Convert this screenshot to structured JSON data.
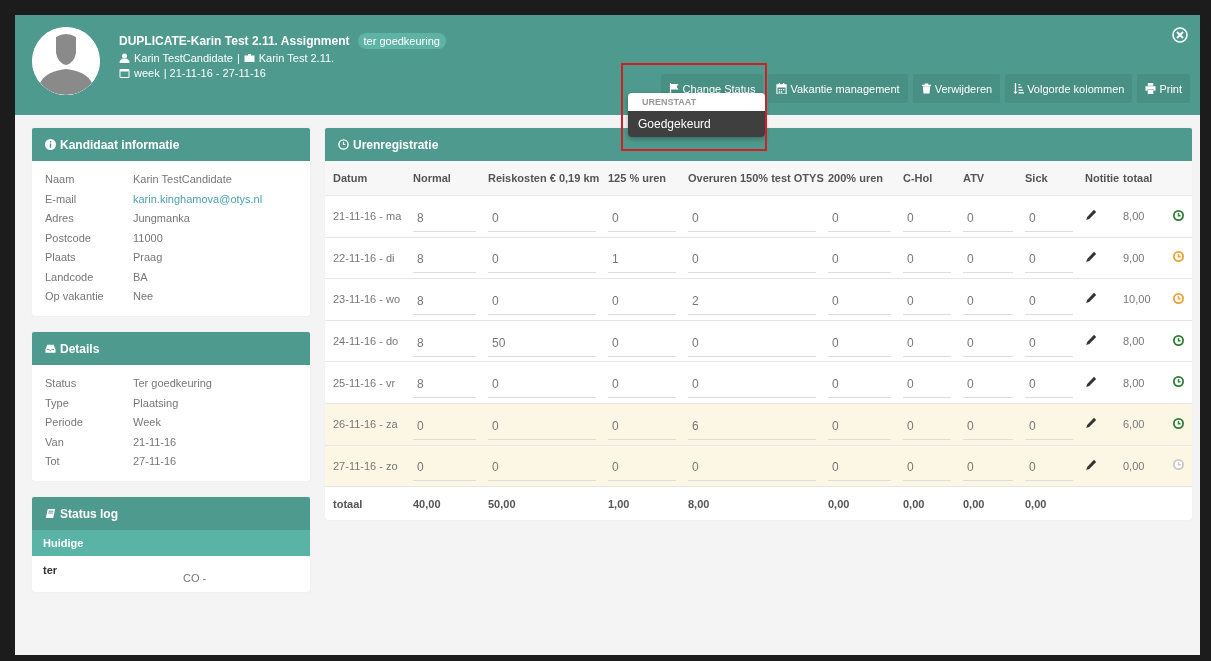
{
  "header": {
    "title": "DUPLICATE-Karin Test 2.11. Assignment",
    "badge": "ter goedkeuring",
    "candidate": "Karin TestCandidate",
    "separator": "|",
    "assignment": "Karin Test 2.11.",
    "period_type": "week",
    "period": "| 21-11-16 - 27-11-16"
  },
  "buttons": [
    {
      "label": "Change Status"
    },
    {
      "label": "Vakantie management"
    },
    {
      "label": "Verwijderen"
    },
    {
      "label": "Volgorde kolommen"
    },
    {
      "label": "Print"
    }
  ],
  "dropdown": {
    "section": "URENSTAAT",
    "items": [
      {
        "label": "Goedgekeurd",
        "selected": true
      }
    ]
  },
  "candidate_card": {
    "title": "Kandidaat informatie",
    "rows": [
      {
        "label": "Naam",
        "value": "Karin TestCandidate",
        "kind": "text"
      },
      {
        "label": "E-mail",
        "value": "karin.kinghamova@otys.nl",
        "kind": "link"
      },
      {
        "label": "Adres",
        "value": "Jungmanka",
        "kind": "text"
      },
      {
        "label": "Postcode",
        "value": "11000",
        "kind": "text"
      },
      {
        "label": "Plaats",
        "value": "Praag",
        "kind": "text"
      },
      {
        "label": "Landcode",
        "value": "BA",
        "kind": "text"
      },
      {
        "label": "Op vakantie",
        "value": "Nee",
        "kind": "text"
      }
    ]
  },
  "details_card": {
    "title": "Details",
    "rows": [
      {
        "label": "Status",
        "value": "Ter goedkeuring"
      },
      {
        "label": "Type",
        "value": "Plaatsing"
      },
      {
        "label": "Periode",
        "value": "Week"
      },
      {
        "label": "Van",
        "value": "21-11-16"
      },
      {
        "label": "Tot",
        "value": "27-11-16"
      }
    ]
  },
  "status_log": {
    "title": "Status log",
    "tab": "Huidige",
    "status": "ter",
    "code": "CO -"
  },
  "timesheet": {
    "title": "Urenregistratie",
    "columns": [
      "Datum",
      "Normal",
      "Reiskosten € 0,19 km",
      "125 % uren",
      "Overuren 150% test OTYS",
      "200% uren",
      "C-Hol",
      "ATV",
      "Sick",
      "Notitie",
      "totaal"
    ],
    "rows": [
      {
        "date": "21-11-16 - ma",
        "values": [
          "8",
          "0",
          "0",
          "0",
          "0",
          "0",
          "0",
          "0"
        ],
        "total": "8,00",
        "color": "#2e7d32",
        "highlighted": false
      },
      {
        "date": "22-11-16 - di",
        "values": [
          "8",
          "0",
          "1",
          "0",
          "0",
          "0",
          "0",
          "0"
        ],
        "total": "9,00",
        "color": "#f0a030",
        "highlighted": false
      },
      {
        "date": "23-11-16 - wo",
        "values": [
          "8",
          "0",
          "0",
          "2",
          "0",
          "0",
          "0",
          "0"
        ],
        "total": "10,00",
        "color": "#f0a030",
        "highlighted": false
      },
      {
        "date": "24-11-16 - do",
        "values": [
          "8",
          "50",
          "0",
          "0",
          "0",
          "0",
          "0",
          "0"
        ],
        "total": "8,00",
        "color": "#2e7d32",
        "highlighted": false
      },
      {
        "date": "25-11-16 - vr",
        "values": [
          "8",
          "0",
          "0",
          "0",
          "0",
          "0",
          "0",
          "0"
        ],
        "total": "8,00",
        "color": "#2e7d32",
        "highlighted": false
      },
      {
        "date": "26-11-16 - za",
        "values": [
          "0",
          "0",
          "0",
          "6",
          "0",
          "0",
          "0",
          "0"
        ],
        "total": "6,00",
        "color": "#2e7d32",
        "highlighted": true
      },
      {
        "date": "27-11-16 - zo",
        "values": [
          "0",
          "0",
          "0",
          "0",
          "0",
          "0",
          "0",
          "0"
        ],
        "total": "0,00",
        "color": "#c8c8c8",
        "highlighted": true
      }
    ],
    "totals": {
      "label": "totaal",
      "values": [
        "40,00",
        "50,00",
        "1,00",
        "8,00",
        "0,00",
        "0,00",
        "0,00",
        "0,00"
      ]
    }
  }
}
